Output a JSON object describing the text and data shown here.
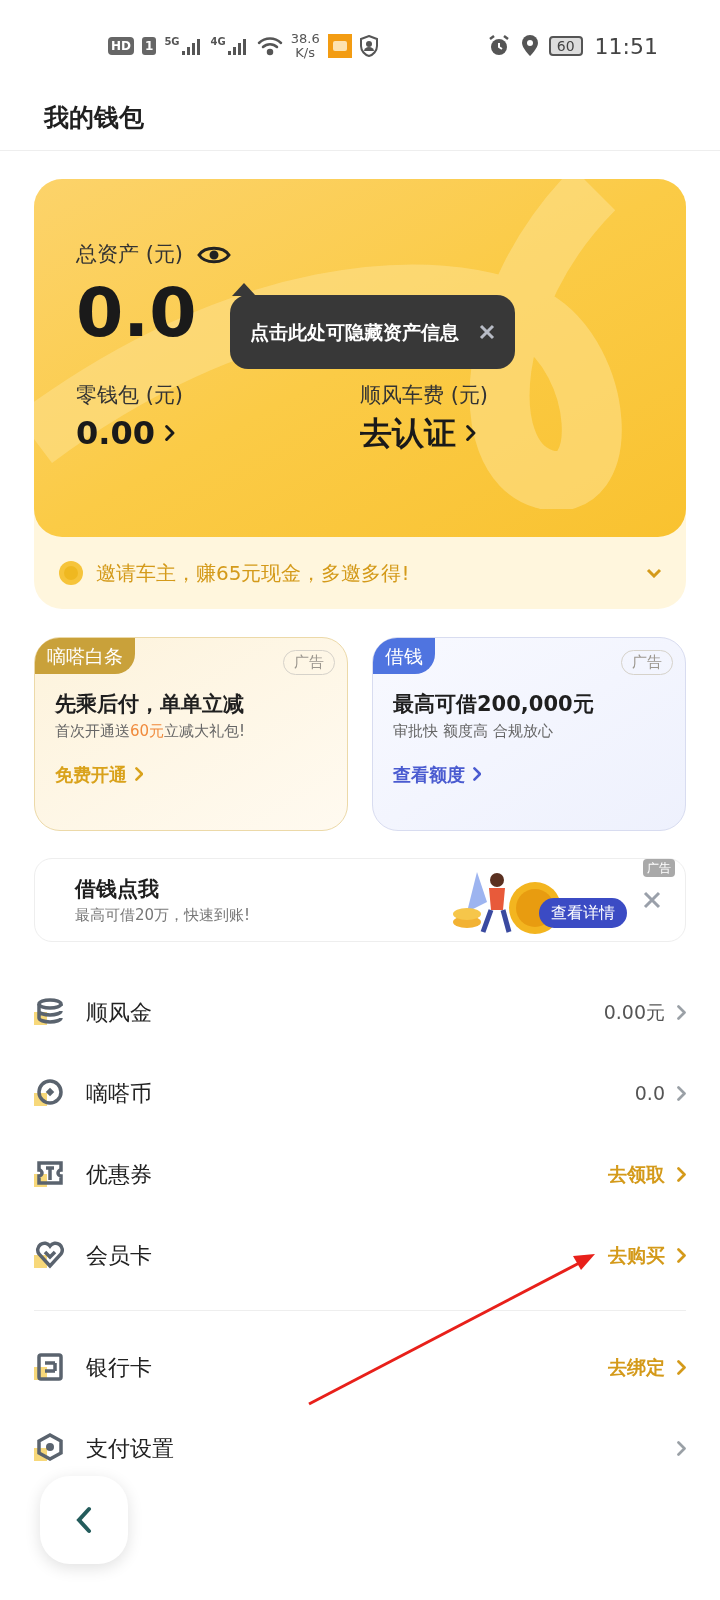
{
  "status_bar": {
    "hd": "HD",
    "sim": "1",
    "net1": "5G",
    "net2": "4G",
    "speed": "38.6",
    "speed_unit": "K/s",
    "battery": "60",
    "time": "11:51"
  },
  "header": {
    "title": "我的钱包"
  },
  "assets": {
    "label": "总资产 (元)",
    "amount": "0.0",
    "tooltip": "点击此处可隐藏资产信息"
  },
  "balances": [
    {
      "label": "零钱包 (元)",
      "value": "0.00"
    },
    {
      "label": "顺风车费 (元)",
      "value": "去认证"
    }
  ],
  "invite": {
    "text": "邀请车主，赚65元现金，多邀多得!"
  },
  "promo_cards": [
    {
      "kind": "gold",
      "tag": "嘀嗒白条",
      "ad": "广告",
      "title": "先乘后付，单单立减",
      "subtitle_before": "首次开通送",
      "subtitle_highlight": "60元",
      "subtitle_after": "立减大礼包!",
      "link": "免费开通"
    },
    {
      "kind": "blue",
      "tag": "借钱",
      "ad": "广告",
      "title": "最高可借200,000元",
      "subtitle_before": "审批快 额度高 合规放心",
      "link": "查看额度"
    }
  ],
  "banner": {
    "title": "借钱点我",
    "subtitle": "最高可借20万，快速到账!",
    "button": "查看详情",
    "ad": "广告"
  },
  "menu_groups": [
    [
      {
        "label": "顺风金",
        "value": "0.00元",
        "kind": "amount"
      },
      {
        "label": "嘀嗒币",
        "value": "0.0",
        "kind": "amount"
      },
      {
        "label": "优惠券",
        "value": "去领取",
        "kind": "action"
      },
      {
        "label": "会员卡",
        "value": "去购买",
        "kind": "action"
      }
    ],
    [
      {
        "label": "银行卡",
        "value": "去绑定",
        "kind": "action"
      },
      {
        "label": "支付设置",
        "kind": "amount"
      }
    ]
  ]
}
